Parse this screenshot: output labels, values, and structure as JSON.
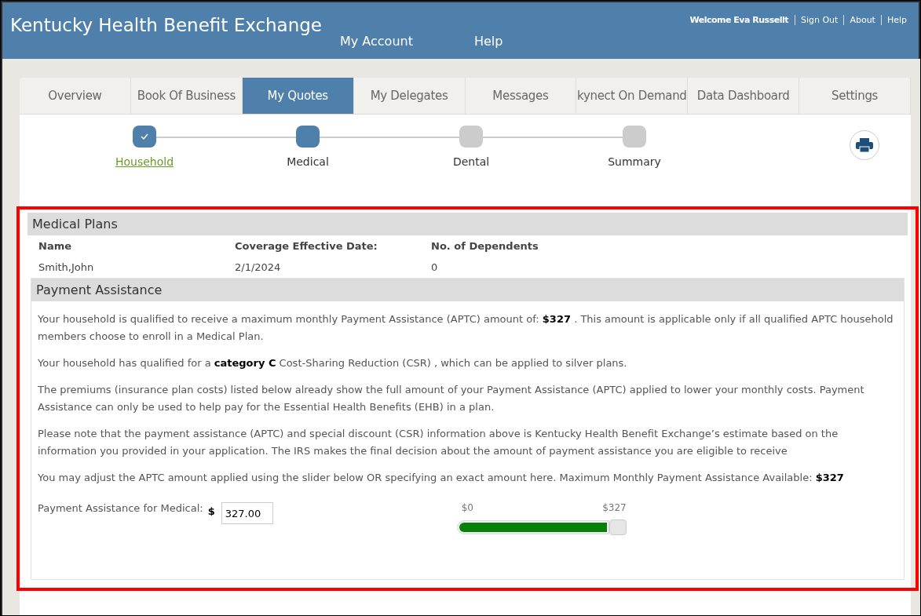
{
  "header": {
    "title": "Kentucky Health Benefit Exchange",
    "nav": [
      "My Account",
      "Help"
    ],
    "welcome": "Welcome Eva Russellt",
    "links": [
      "Sign Out",
      "About",
      "Help"
    ]
  },
  "tabs": [
    {
      "label": "Overview",
      "selected": false
    },
    {
      "label": "Book Of Business",
      "selected": false
    },
    {
      "label": "My Quotes",
      "selected": true
    },
    {
      "label": "My Delegates",
      "selected": false
    },
    {
      "label": "Messages",
      "selected": false
    },
    {
      "label": "kynect On Demand",
      "selected": false
    },
    {
      "label": "Data Dashboard",
      "selected": false
    },
    {
      "label": "Settings",
      "selected": false
    }
  ],
  "steps": [
    {
      "label": "Household",
      "kind": "done"
    },
    {
      "label": "Medical",
      "kind": "current"
    },
    {
      "label": "Dental",
      "kind": "pending"
    },
    {
      "label": "Summary",
      "kind": "pending"
    }
  ],
  "medical_plans": {
    "title": "Medical Plans",
    "columns": [
      "Name",
      "Coverage Effective Date:",
      "No. of Dependents"
    ],
    "row": [
      "Smith,John",
      "2/1/2024",
      "0"
    ]
  },
  "payment_assistance": {
    "title": "Payment Assistance",
    "paragraphs": [
      "Your household is qualified to receive a maximum monthly Payment Assistance (APTC) amount of: **$327** . This amount is applicable only if all qualified APTC household members choose to enroll in a Medical Plan.",
      "Your household has qualified for a **category C** Cost-Sharing Reduction (CSR) , which can be applied to silver plans.",
      "The premiums (insurance plan costs) listed below already show the full amount of your Payment Assistance (APTC) applied to lower your monthly costs. Payment Assistance can only be used to help pay for the Essential Health Benefits (EHB) in a plan.",
      "Please note that the payment assistance (APTC) and special discount (CSR) information above is Kentucky Health Benefit Exchange’s estimate based on the information you provided in your application. The IRS makes the final decision about the amount of payment assistance you are eligible to receive",
      "You may adjust the APTC amount applied using the slider below OR specifying an exact amount here. Maximum Monthly Payment Assistance Available:  **$327**"
    ],
    "field_label": "Payment Assistance for Medical:",
    "currency": "$",
    "amount": "327.00",
    "slider": {
      "min_label": "$0",
      "max_label": "$327",
      "level": 1
    }
  }
}
